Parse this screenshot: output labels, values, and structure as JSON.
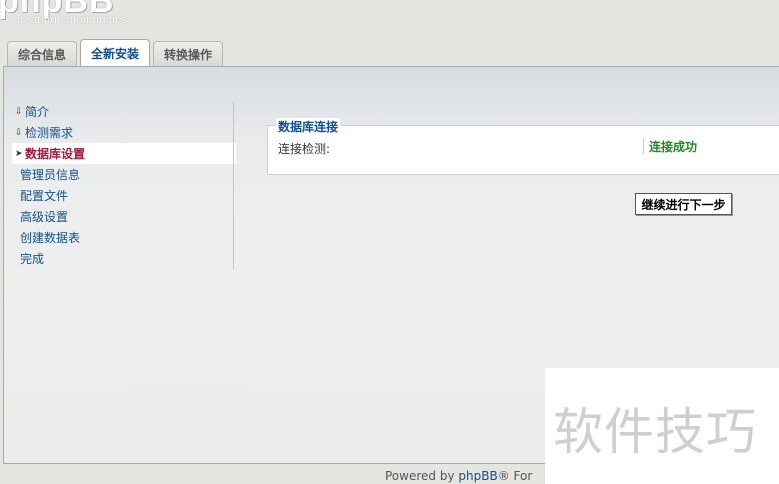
{
  "header": {
    "logo_text": "phpBB",
    "logo_tagline": "creating communities"
  },
  "tabs": [
    {
      "label": "综合信息",
      "active": false
    },
    {
      "label": "全新安装",
      "active": true
    },
    {
      "label": "转换操作",
      "active": false
    }
  ],
  "menu": {
    "items": [
      {
        "label": "简介",
        "state": "done"
      },
      {
        "label": "检测需求",
        "state": "done"
      },
      {
        "label": "数据库设置",
        "state": "current"
      },
      {
        "label": "管理员信息",
        "state": "pending"
      },
      {
        "label": "配置文件",
        "state": "pending"
      },
      {
        "label": "高级设置",
        "state": "pending"
      },
      {
        "label": "创建数据表",
        "state": "pending"
      },
      {
        "label": "完成",
        "state": "pending"
      }
    ]
  },
  "main": {
    "fieldset_legend": "数据库连接",
    "row_label": "连接检测:",
    "row_value": "连接成功",
    "next_button": "继续进行下一步"
  },
  "footer": {
    "prefix": "Powered by ",
    "link": "phpBB",
    "suffix": "® For"
  },
  "watermark": {
    "text": "软件技巧"
  },
  "colors": {
    "link": "#105289",
    "current_step": "#a21a42",
    "success": "#228822",
    "legend": "#115098"
  }
}
